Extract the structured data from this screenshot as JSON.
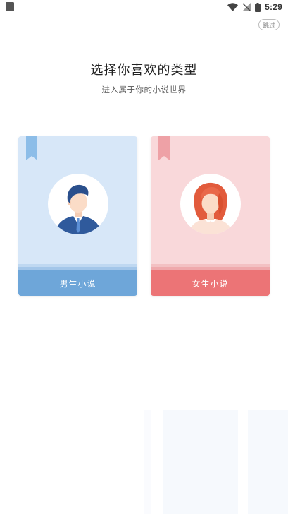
{
  "status_bar": {
    "time": "5:29"
  },
  "header": {
    "skip_label": "跳过",
    "title": "选择你喜欢的类型",
    "subtitle": "进入属于你的小说世界"
  },
  "cards": [
    {
      "label": "男生小说",
      "accent": "#6ea6d9",
      "background": "#d7e7f8",
      "icon": "male-avatar-icon"
    },
    {
      "label": "女生小说",
      "accent": "#ec7476",
      "background": "#f9d8da",
      "icon": "female-avatar-icon"
    }
  ]
}
